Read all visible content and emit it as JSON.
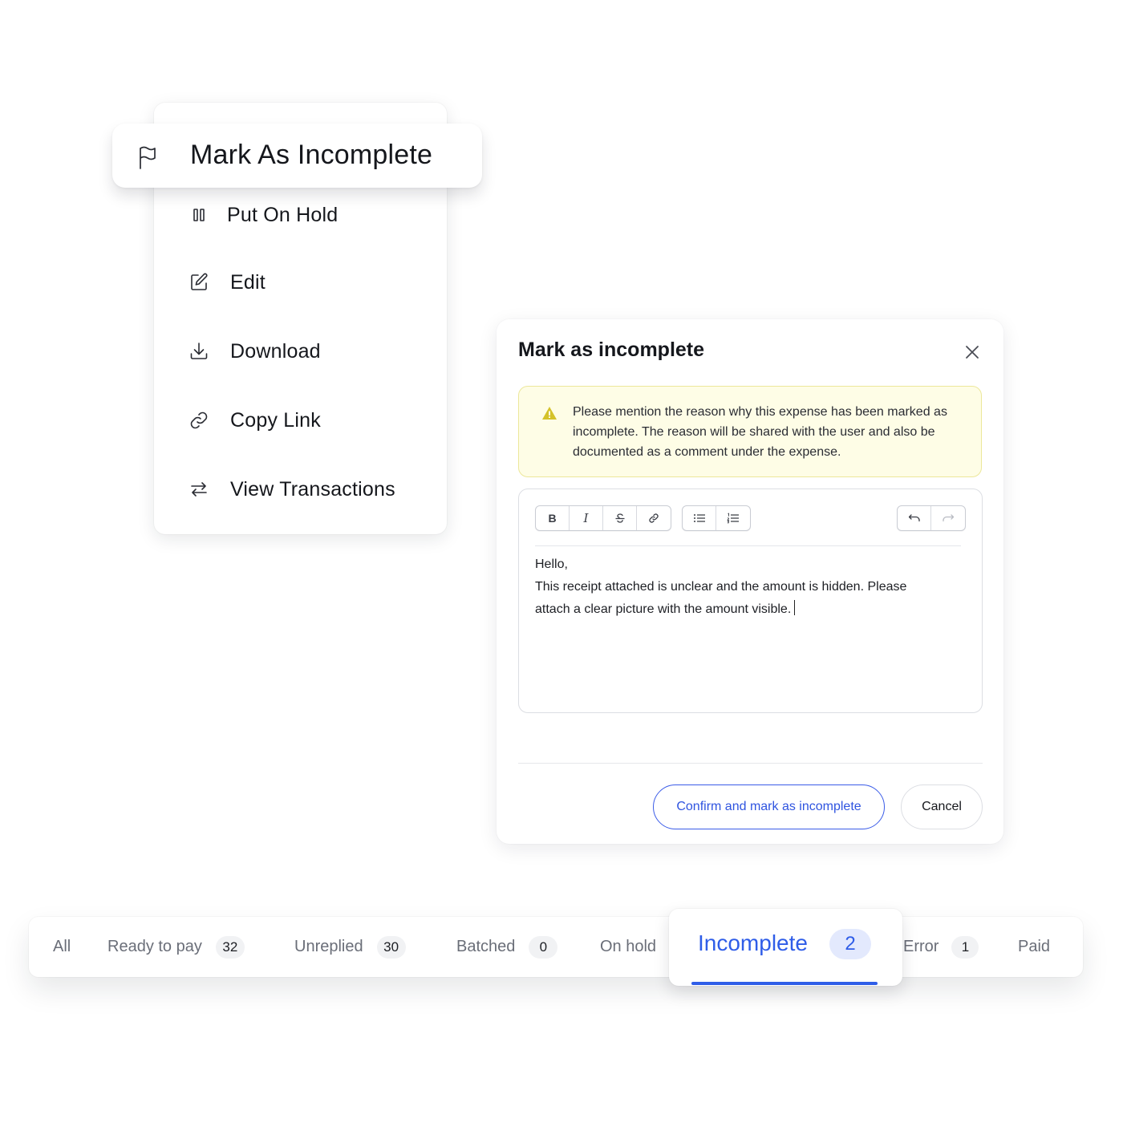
{
  "menu": {
    "highlighted_label": "Mark As Incomplete",
    "items": [
      {
        "label": "Put On Hold",
        "icon": "pause-icon"
      },
      {
        "label": "Edit",
        "icon": "edit-icon"
      },
      {
        "label": "Download",
        "icon": "download-icon"
      },
      {
        "label": "Copy Link",
        "icon": "link-icon"
      },
      {
        "label": "View Transactions",
        "icon": "transfer-icon"
      }
    ]
  },
  "modal": {
    "title": "Mark as incomplete",
    "alert_text": "Please mention the reason why this expense has been marked as incomplete. The reason will be shared with the user and also be documented as a comment under the expense.",
    "toolbar": {
      "bold": "B",
      "italic": "I"
    },
    "editor_lines": [
      "Hello,",
      "This receipt attached is unclear and the amount is hidden. Please",
      "attach a clear picture with the amount visible."
    ],
    "confirm_label": "Confirm and mark as incomplete",
    "cancel_label": "Cancel"
  },
  "tabs": [
    {
      "label": "All"
    },
    {
      "label": "Ready to pay",
      "count": "32"
    },
    {
      "label": "Unreplied",
      "count": "30"
    },
    {
      "label": "Batched",
      "count": "0"
    },
    {
      "label": "On hold"
    },
    {
      "label": "Incomplete",
      "count": "2",
      "active": true
    },
    {
      "label": "Error",
      "count": "1"
    },
    {
      "label": "Paid"
    }
  ],
  "colors": {
    "accent": "#2f5de8",
    "alert_bg": "#fefde6",
    "alert_border": "#ece79a",
    "warning": "#d4c22a"
  }
}
